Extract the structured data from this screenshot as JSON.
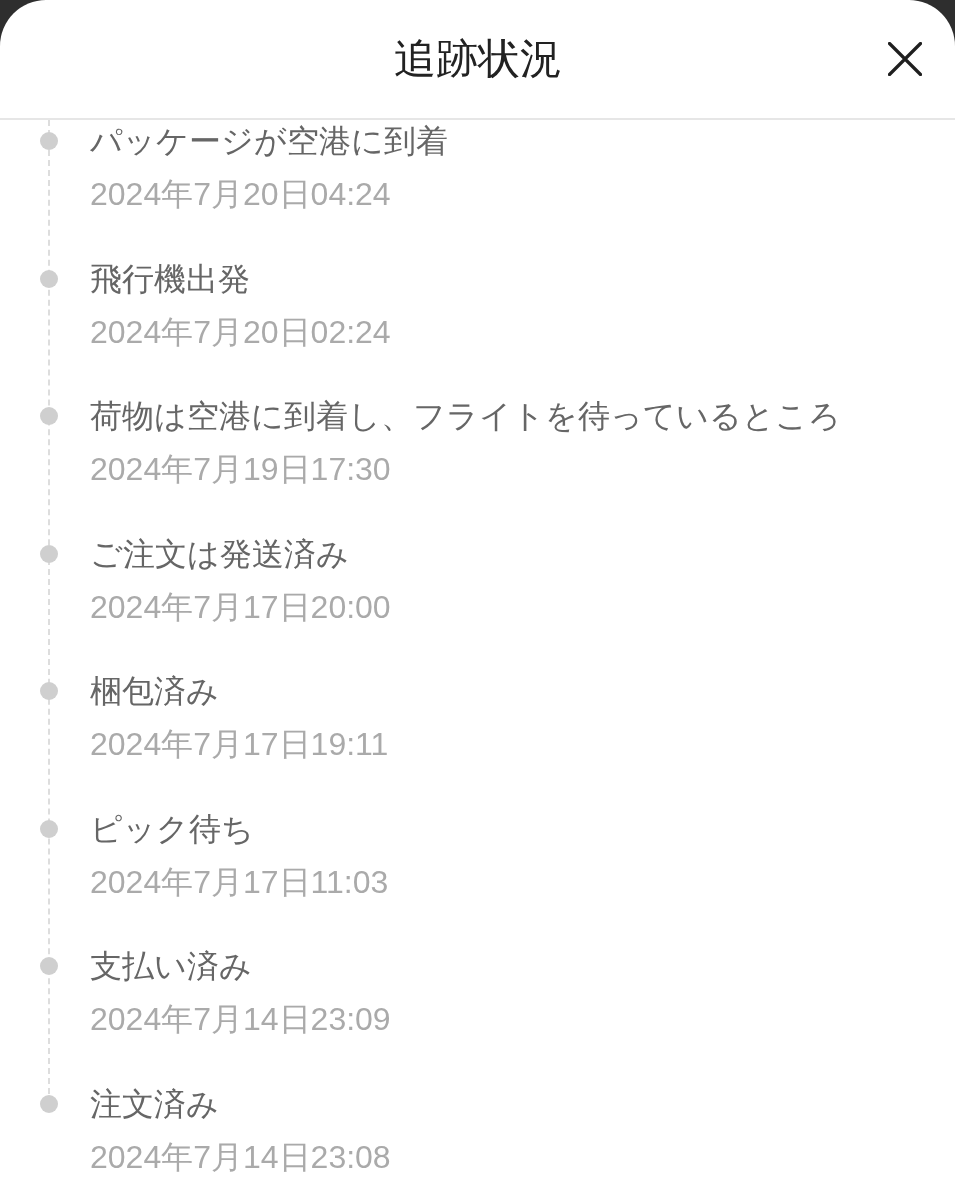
{
  "header": {
    "title": "追跡状況"
  },
  "events": [
    {
      "status": "パッケージが空港に到着",
      "time": "2024年7月20日04:24"
    },
    {
      "status": "飛行機出発",
      "time": "2024年7月20日02:24"
    },
    {
      "status": "荷物は空港に到着し、フライトを待っているところ",
      "time": "2024年7月19日17:30"
    },
    {
      "status": "ご注文は発送済み",
      "time": "2024年7月17日20:00"
    },
    {
      "status": "梱包済み",
      "time": "2024年7月17日19:11"
    },
    {
      "status": "ピック待ち",
      "time": "2024年7月17日11:03"
    },
    {
      "status": "支払い済み",
      "time": "2024年7月14日23:09"
    },
    {
      "status": "注文済み",
      "time": "2024年7月14日23:08"
    }
  ]
}
